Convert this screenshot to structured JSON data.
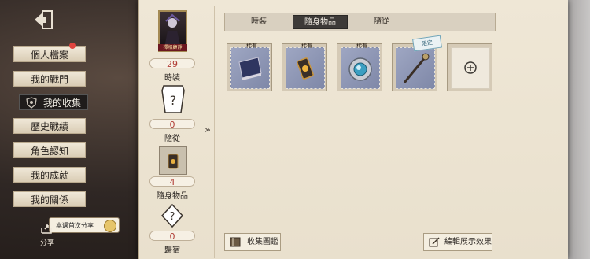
{
  "sidebar": {
    "items": [
      {
        "label": "個人檔案"
      },
      {
        "label": "我的戰門"
      },
      {
        "label": "我的收集"
      },
      {
        "label": "歷史戰績"
      },
      {
        "label": "角色認知"
      },
      {
        "label": "我的成就"
      },
      {
        "label": "我的關係"
      }
    ],
    "share_note": "本週首次分享",
    "share_label": "分享"
  },
  "profile": {
    "portrait_label": "擇相顧靜",
    "stats": [
      {
        "count": "29",
        "label": "時裝"
      },
      {
        "count": "0",
        "label": "隨從"
      },
      {
        "count": "4",
        "label": "隨身物品"
      },
      {
        "count": "0",
        "label": "歸宿"
      }
    ]
  },
  "tabs": [
    {
      "label": "時裝"
    },
    {
      "label": "隨身物品"
    },
    {
      "label": "隨從"
    }
  ],
  "items": [
    {
      "icon": "book-icon",
      "tag": "稀有"
    },
    {
      "icon": "lantern-icon",
      "tag": "稀有"
    },
    {
      "icon": "pendant-icon",
      "tag": "稀有"
    },
    {
      "icon": "staff-icon",
      "tag": "限定"
    }
  ],
  "buttons": {
    "gallery": "收集圖鑑",
    "edit": "編輯展示效果"
  }
}
